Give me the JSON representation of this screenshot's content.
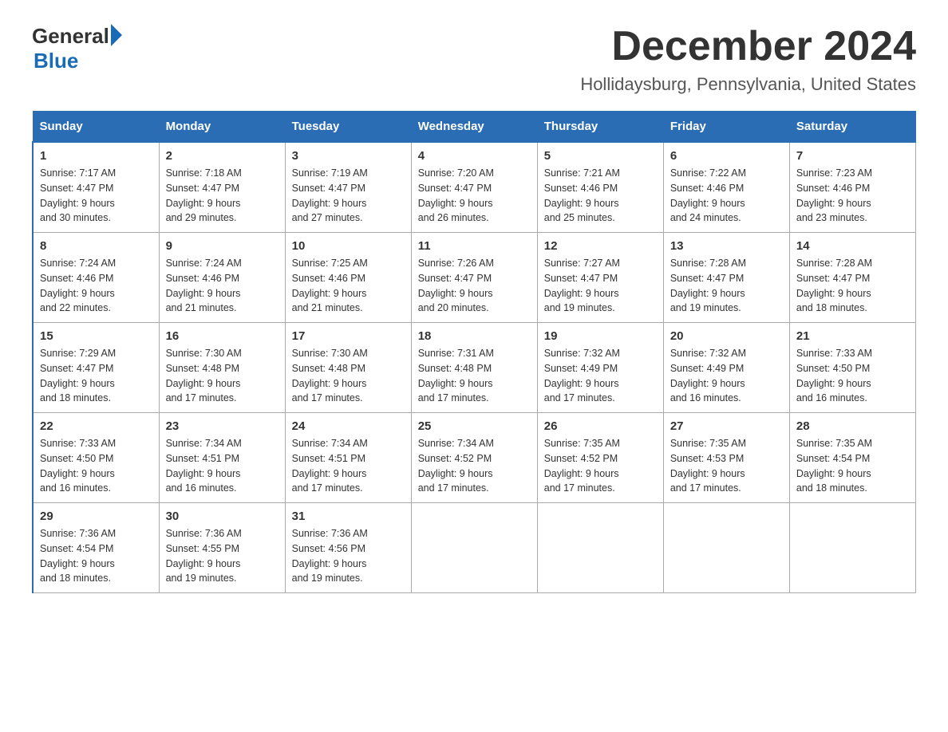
{
  "header": {
    "logo_general": "General",
    "logo_blue": "Blue",
    "month_title": "December 2024",
    "location": "Hollidaysburg, Pennsylvania, United States"
  },
  "days_of_week": [
    "Sunday",
    "Monday",
    "Tuesday",
    "Wednesday",
    "Thursday",
    "Friday",
    "Saturday"
  ],
  "weeks": [
    [
      {
        "day": "1",
        "sunrise": "7:17 AM",
        "sunset": "4:47 PM",
        "daylight": "9 hours and 30 minutes."
      },
      {
        "day": "2",
        "sunrise": "7:18 AM",
        "sunset": "4:47 PM",
        "daylight": "9 hours and 29 minutes."
      },
      {
        "day": "3",
        "sunrise": "7:19 AM",
        "sunset": "4:47 PM",
        "daylight": "9 hours and 27 minutes."
      },
      {
        "day": "4",
        "sunrise": "7:20 AM",
        "sunset": "4:47 PM",
        "daylight": "9 hours and 26 minutes."
      },
      {
        "day": "5",
        "sunrise": "7:21 AM",
        "sunset": "4:46 PM",
        "daylight": "9 hours and 25 minutes."
      },
      {
        "day": "6",
        "sunrise": "7:22 AM",
        "sunset": "4:46 PM",
        "daylight": "9 hours and 24 minutes."
      },
      {
        "day": "7",
        "sunrise": "7:23 AM",
        "sunset": "4:46 PM",
        "daylight": "9 hours and 23 minutes."
      }
    ],
    [
      {
        "day": "8",
        "sunrise": "7:24 AM",
        "sunset": "4:46 PM",
        "daylight": "9 hours and 22 minutes."
      },
      {
        "day": "9",
        "sunrise": "7:24 AM",
        "sunset": "4:46 PM",
        "daylight": "9 hours and 21 minutes."
      },
      {
        "day": "10",
        "sunrise": "7:25 AM",
        "sunset": "4:46 PM",
        "daylight": "9 hours and 21 minutes."
      },
      {
        "day": "11",
        "sunrise": "7:26 AM",
        "sunset": "4:47 PM",
        "daylight": "9 hours and 20 minutes."
      },
      {
        "day": "12",
        "sunrise": "7:27 AM",
        "sunset": "4:47 PM",
        "daylight": "9 hours and 19 minutes."
      },
      {
        "day": "13",
        "sunrise": "7:28 AM",
        "sunset": "4:47 PM",
        "daylight": "9 hours and 19 minutes."
      },
      {
        "day": "14",
        "sunrise": "7:28 AM",
        "sunset": "4:47 PM",
        "daylight": "9 hours and 18 minutes."
      }
    ],
    [
      {
        "day": "15",
        "sunrise": "7:29 AM",
        "sunset": "4:47 PM",
        "daylight": "9 hours and 18 minutes."
      },
      {
        "day": "16",
        "sunrise": "7:30 AM",
        "sunset": "4:48 PM",
        "daylight": "9 hours and 17 minutes."
      },
      {
        "day": "17",
        "sunrise": "7:30 AM",
        "sunset": "4:48 PM",
        "daylight": "9 hours and 17 minutes."
      },
      {
        "day": "18",
        "sunrise": "7:31 AM",
        "sunset": "4:48 PM",
        "daylight": "9 hours and 17 minutes."
      },
      {
        "day": "19",
        "sunrise": "7:32 AM",
        "sunset": "4:49 PM",
        "daylight": "9 hours and 17 minutes."
      },
      {
        "day": "20",
        "sunrise": "7:32 AM",
        "sunset": "4:49 PM",
        "daylight": "9 hours and 16 minutes."
      },
      {
        "day": "21",
        "sunrise": "7:33 AM",
        "sunset": "4:50 PM",
        "daylight": "9 hours and 16 minutes."
      }
    ],
    [
      {
        "day": "22",
        "sunrise": "7:33 AM",
        "sunset": "4:50 PM",
        "daylight": "9 hours and 16 minutes."
      },
      {
        "day": "23",
        "sunrise": "7:34 AM",
        "sunset": "4:51 PM",
        "daylight": "9 hours and 16 minutes."
      },
      {
        "day": "24",
        "sunrise": "7:34 AM",
        "sunset": "4:51 PM",
        "daylight": "9 hours and 17 minutes."
      },
      {
        "day": "25",
        "sunrise": "7:34 AM",
        "sunset": "4:52 PM",
        "daylight": "9 hours and 17 minutes."
      },
      {
        "day": "26",
        "sunrise": "7:35 AM",
        "sunset": "4:52 PM",
        "daylight": "9 hours and 17 minutes."
      },
      {
        "day": "27",
        "sunrise": "7:35 AM",
        "sunset": "4:53 PM",
        "daylight": "9 hours and 17 minutes."
      },
      {
        "day": "28",
        "sunrise": "7:35 AM",
        "sunset": "4:54 PM",
        "daylight": "9 hours and 18 minutes."
      }
    ],
    [
      {
        "day": "29",
        "sunrise": "7:36 AM",
        "sunset": "4:54 PM",
        "daylight": "9 hours and 18 minutes."
      },
      {
        "day": "30",
        "sunrise": "7:36 AM",
        "sunset": "4:55 PM",
        "daylight": "9 hours and 19 minutes."
      },
      {
        "day": "31",
        "sunrise": "7:36 AM",
        "sunset": "4:56 PM",
        "daylight": "9 hours and 19 minutes."
      },
      null,
      null,
      null,
      null
    ]
  ],
  "labels": {
    "sunrise": "Sunrise:",
    "sunset": "Sunset:",
    "daylight": "Daylight:"
  }
}
